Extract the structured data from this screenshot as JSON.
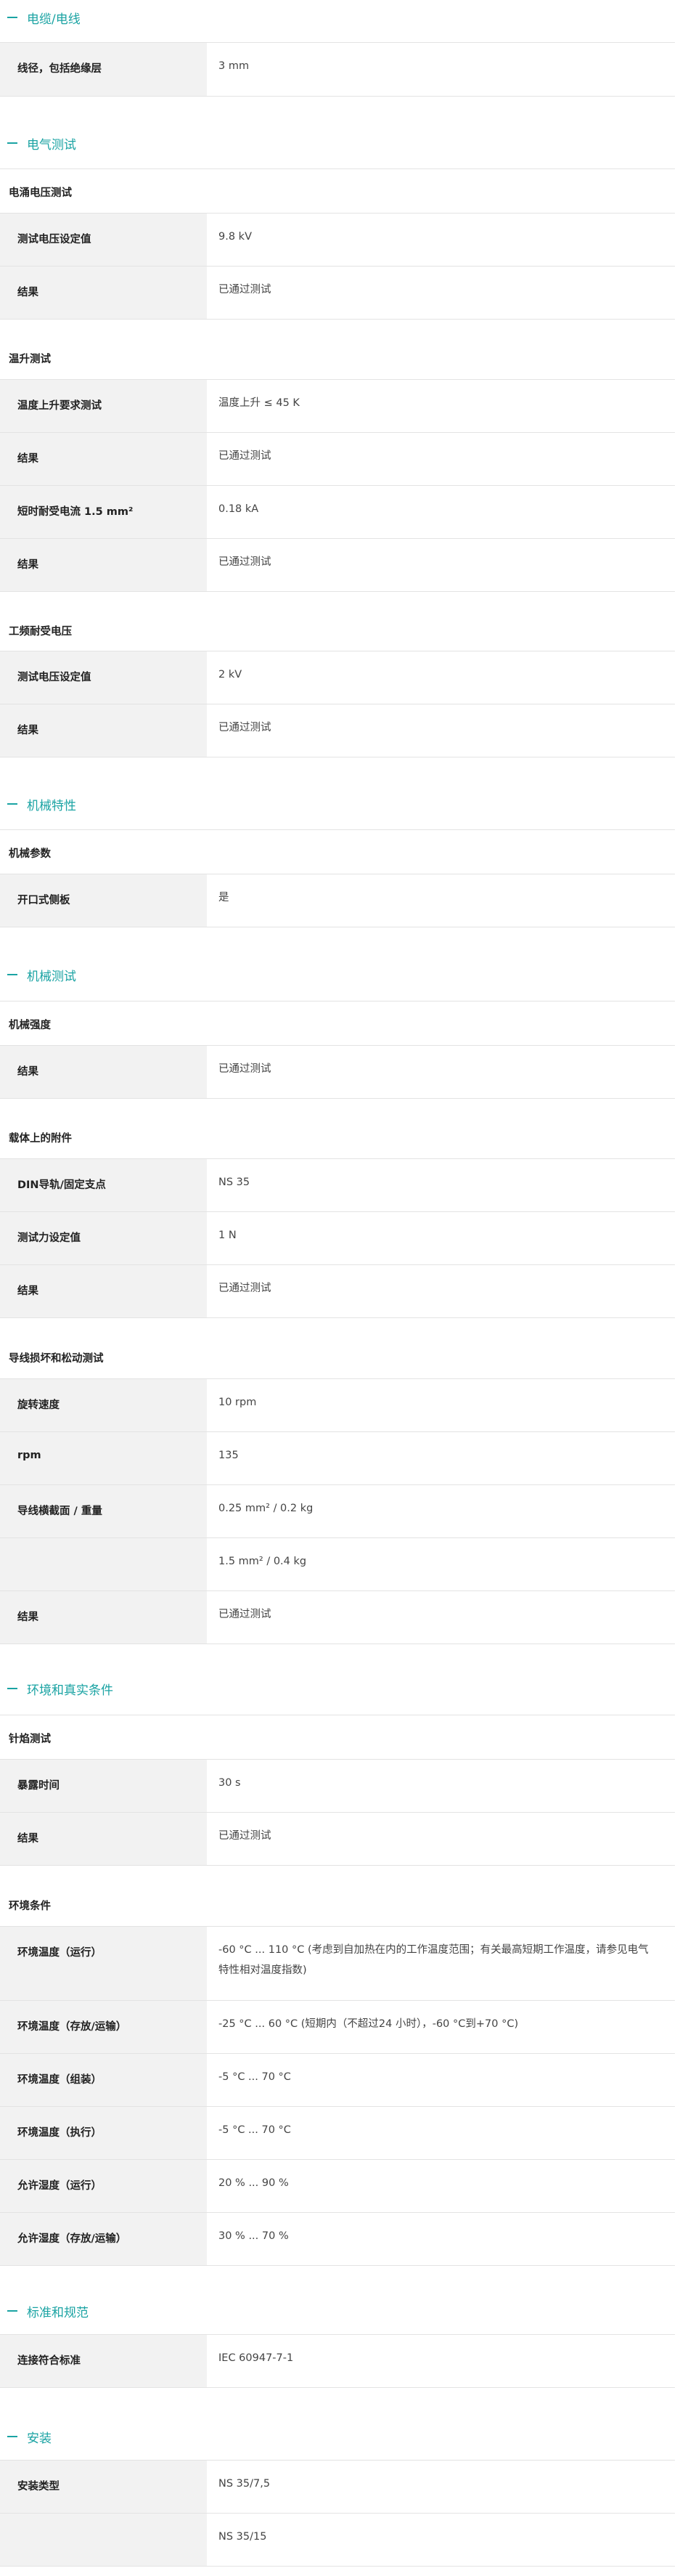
{
  "sections": {
    "s1": {
      "title": "电缆/电线"
    },
    "s2": {
      "title": "电气测试"
    },
    "s3": {
      "title": "机械特性"
    },
    "s4": {
      "title": "机械测试"
    },
    "s5": {
      "title": "环境和真实条件"
    },
    "s6": {
      "title": "标准和规范"
    },
    "s7": {
      "title": "安装"
    }
  },
  "groups": {
    "g1": "电涌电压测试",
    "g2": "温升测试",
    "g3": "工频耐受电压",
    "g4": "机械参数",
    "g5": "机械强度",
    "g6": "载体上的附件",
    "g7": "导线损坏和松动测试",
    "g8": "针焰测试",
    "g9": "环境条件"
  },
  "rows": {
    "r1": {
      "label": "线径，包括绝缘层",
      "value": "3 mm"
    },
    "r2": {
      "label": "测试电压设定值",
      "value": "9.8 kV"
    },
    "r3": {
      "label": "结果",
      "value": "已通过测试"
    },
    "r4": {
      "label": "温度上升要求测试",
      "value": "温度上升 ≤ 45 K"
    },
    "r5": {
      "label": "结果",
      "value": "已通过测试"
    },
    "r6": {
      "label": "短时耐受电流 1.5 mm²",
      "value": "0.18 kA"
    },
    "r7": {
      "label": "结果",
      "value": "已通过测试"
    },
    "r8": {
      "label": "测试电压设定值",
      "value": "2 kV"
    },
    "r9": {
      "label": "结果",
      "value": "已通过测试"
    },
    "r10": {
      "label": "开口式侧板",
      "value": "是"
    },
    "r11": {
      "label": "结果",
      "value": "已通过测试"
    },
    "r12": {
      "label": "DIN导轨/固定支点",
      "value": "NS 35"
    },
    "r13": {
      "label": "测试力设定值",
      "value": "1 N"
    },
    "r14": {
      "label": "结果",
      "value": "已通过测试"
    },
    "r15": {
      "label": "旋转速度",
      "value": "10 rpm"
    },
    "r16": {
      "label": "rpm",
      "value": "135"
    },
    "r17": {
      "label": "导线横截面 / 重量",
      "value": "0.25 mm² / 0.2 kg"
    },
    "r17b": {
      "value": "1.5 mm² / 0.4 kg"
    },
    "r18": {
      "label": "结果",
      "value": "已通过测试"
    },
    "r19": {
      "label": "暴露时间",
      "value": "30 s"
    },
    "r20": {
      "label": "结果",
      "value": "已通过测试"
    },
    "r21": {
      "label": "环境温度（运行）",
      "value": "-60 °C ... 110 °C (考虑到自加热在内的工作温度范围；有关最高短期工作温度，请参见电气特性相对温度指数)"
    },
    "r22": {
      "label": "环境温度（存放/运输）",
      "value": "-25 °C ... 60 °C (短期内（不超过24 小时），-60 °C到+70 °C)"
    },
    "r23": {
      "label": "环境温度（组装）",
      "value": "-5 °C ... 70 °C"
    },
    "r24": {
      "label": "环境温度（执行）",
      "value": "-5 °C ... 70 °C"
    },
    "r25": {
      "label": "允许湿度（运行）",
      "value": "20 % ... 90 %"
    },
    "r26": {
      "label": "允许湿度（存放/运输）",
      "value": "30 % ... 70 %"
    },
    "r27": {
      "label": "连接符合标准",
      "value": "IEC 60947-7-1"
    },
    "r28": {
      "label": "安装类型",
      "value": "NS 35/7,5"
    },
    "r28b": {
      "value": "NS 35/15"
    }
  }
}
